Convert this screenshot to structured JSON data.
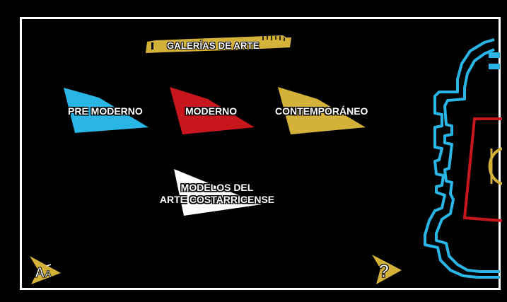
{
  "header": {
    "title": "GALERÍAS DE ARTE"
  },
  "galleries": [
    {
      "label": "PRE MODERNO",
      "color": "#29b6e6"
    },
    {
      "label": "MODERNO",
      "color": "#c8161d"
    },
    {
      "label": "CONTEMPORÁNEO",
      "color": "#d4b23a"
    },
    {
      "label_line1": "MODELOS DEL",
      "label_line2": "ARTE COSTARRICENSE",
      "color": "#ffffff"
    }
  ],
  "controls": {
    "font_size_icon_label": "AA",
    "help_icon_label": "?",
    "icon_color": "#d4b23a"
  },
  "colors": {
    "background": "#000000",
    "frame": "#ffffff",
    "banner": "#d4b23a"
  }
}
